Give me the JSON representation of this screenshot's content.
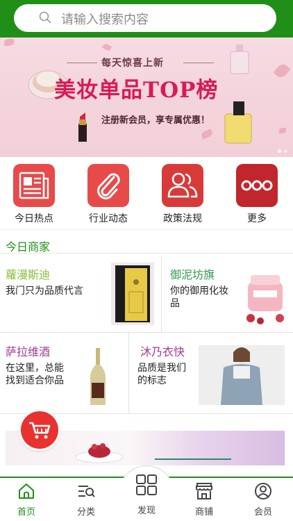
{
  "search": {
    "placeholder": "请输入搜索内容"
  },
  "banner": {
    "tag": "每天惊喜上新",
    "title": "美妆单品TOP榜",
    "subtitle": "注册新会员，享专属优惠！",
    "slide_count": 2,
    "active_slide": 1
  },
  "quicknav": [
    {
      "label": "今日热点",
      "icon": "newspaper-icon",
      "color": "#e84a4a"
    },
    {
      "label": "行业动态",
      "icon": "paperclip-icon",
      "color": "#e84a4a"
    },
    {
      "label": "政策法规",
      "icon": "users-icon",
      "color": "#d83a3a"
    },
    {
      "label": "更多",
      "icon": "more-dots-icon",
      "color": "#c0262c"
    }
  ],
  "section": {
    "title": "今日商家"
  },
  "merchants": [
    {
      "name": "蘿漫斯迪",
      "desc": "我门只为品质代言",
      "color": "#8bbf3a"
    },
    {
      "name": "御泥坊旗",
      "desc": "你的御用化妆品",
      "color": "#2f9b4a"
    },
    {
      "name": "萨拉维酒",
      "desc": "在这里，总能找到适合你品",
      "color": "#a13a8f"
    },
    {
      "name": "沐乃衣快",
      "desc": "品质是我们的标志",
      "color": "#a13a8f"
    }
  ],
  "tabs": [
    {
      "label": "首页",
      "icon": "home-icon",
      "active": true
    },
    {
      "label": "分类",
      "icon": "category-icon",
      "active": false
    },
    {
      "label": "发现",
      "icon": "grid-icon",
      "active": false
    },
    {
      "label": "商铺",
      "icon": "shop-icon",
      "active": false
    },
    {
      "label": "会员",
      "icon": "user-icon",
      "active": false
    }
  ],
  "colors": {
    "brand": "#1f8f17",
    "accent": "#e8322f"
  }
}
